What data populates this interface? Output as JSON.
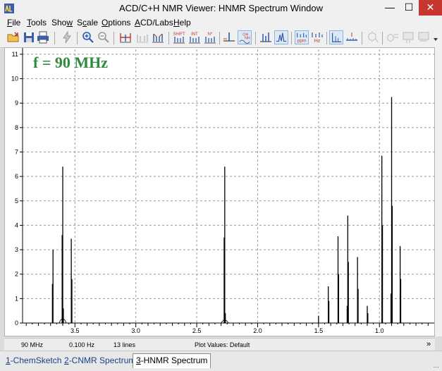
{
  "window": {
    "title": "ACD/C+H NMR Viewer: HNMR Spectrum Window",
    "minimize_glyph": "—",
    "maximize_glyph": "☐",
    "close_glyph": "✕"
  },
  "menu": [
    {
      "key": "F",
      "rest": "ile"
    },
    {
      "key": "T",
      "rest": "ools"
    },
    {
      "pre": "Sho",
      "key": "w",
      "rest": ""
    },
    {
      "pre": "S",
      "key": "c",
      "rest": "ale"
    },
    {
      "key": "O",
      "rest": "ptions"
    },
    {
      "key": "A",
      "rest": "CD/Labs"
    },
    {
      "key": "H",
      "rest": "elp"
    }
  ],
  "toolbar": {
    "shift_label": "SHIFT",
    "int_label": "INT",
    "nstar_label": "N*",
    "oh_label": "OH",
    "nh_label": "NH",
    "ppm_label": "ppm",
    "hz_label": "Hz"
  },
  "spectrum": {
    "frequency_label": "f = 90 MHz",
    "accent_color": "#2e8b3e"
  },
  "chart_data": {
    "type": "line",
    "title": "",
    "xlabel": "",
    "ylabel": "",
    "x_ticks": [
      "3.5",
      "3.0",
      "2.5",
      "2.0",
      "1.5",
      "1.0"
    ],
    "y_ticks": [
      "0",
      "1",
      "2",
      "3",
      "4",
      "5",
      "6",
      "7",
      "8",
      "9",
      "10",
      "11"
    ],
    "xlim": [
      3.93,
      0.55
    ],
    "ylim": [
      0,
      11.2
    ],
    "grid": true,
    "x_reversed": true,
    "peaks": [
      {
        "x": 3.68,
        "y": 3.0
      },
      {
        "x": 3.685,
        "y": 1.6
      },
      {
        "x": 3.6,
        "y": 6.4
      },
      {
        "x": 3.605,
        "y": 3.6
      },
      {
        "x": 3.595,
        "y": 0.6
      },
      {
        "x": 3.53,
        "y": 3.45
      },
      {
        "x": 3.525,
        "y": 1.8
      },
      {
        "x": 2.27,
        "y": 6.4
      },
      {
        "x": 2.275,
        "y": 3.5
      },
      {
        "x": 2.265,
        "y": 0.4
      },
      {
        "x": 1.5,
        "y": 0.3
      },
      {
        "x": 1.42,
        "y": 1.5
      },
      {
        "x": 1.415,
        "y": 0.9
      },
      {
        "x": 1.34,
        "y": 3.55
      },
      {
        "x": 1.335,
        "y": 2.0
      },
      {
        "x": 1.26,
        "y": 4.4
      },
      {
        "x": 1.255,
        "y": 2.5
      },
      {
        "x": 1.265,
        "y": 0.7
      },
      {
        "x": 1.18,
        "y": 2.7
      },
      {
        "x": 1.175,
        "y": 1.4
      },
      {
        "x": 1.1,
        "y": 0.7
      },
      {
        "x": 1.095,
        "y": 0.4
      },
      {
        "x": 0.98,
        "y": 6.85
      },
      {
        "x": 0.975,
        "y": 4.0
      },
      {
        "x": 0.9,
        "y": 9.25
      },
      {
        "x": 0.895,
        "y": 4.8
      },
      {
        "x": 0.905,
        "y": 1.2
      },
      {
        "x": 0.83,
        "y": 3.15
      },
      {
        "x": 0.825,
        "y": 1.8
      }
    ]
  },
  "status": {
    "frequency": "90 MHz",
    "resolution": "0.100 Hz",
    "lines": "13 lines",
    "plot_values": "Plot Values: Default",
    "expand": "»"
  },
  "tabs": [
    {
      "key": "1",
      "rest": "-ChemSketch",
      "active": false
    },
    {
      "key": "2",
      "rest": "-CNMR Spectrum",
      "active": false
    },
    {
      "key": "3",
      "rest": "-HNMR Spectrum",
      "active": true
    }
  ],
  "grip": "..."
}
